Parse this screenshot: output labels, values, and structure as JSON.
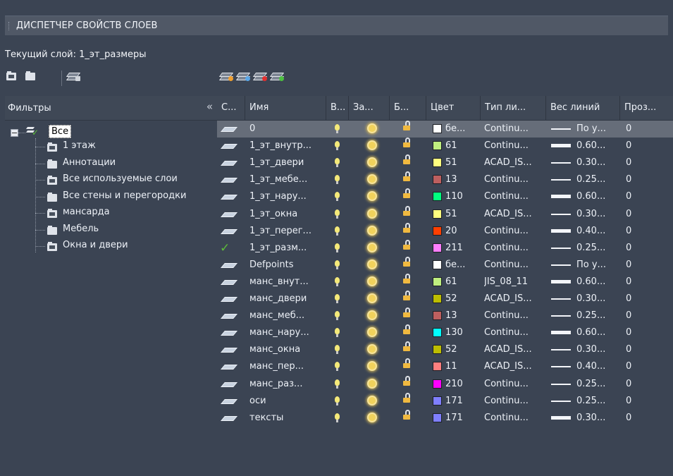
{
  "window": {
    "title": "ДИСПЕТЧЕР СВОЙСТВ СЛОЕВ"
  },
  "current_layer": "Текущий слой: 1_эт_размеры",
  "toolbar_left": [
    "new-property-filter-icon",
    "new-group-filter-icon",
    "layer-states-manager-icon"
  ],
  "toolbar_right": [
    "new-layer-icon",
    "new-layer-vp-frozen-icon",
    "delete-layer-icon",
    "set-current-icon"
  ],
  "filters": {
    "header": "Фильтры",
    "collapse": "«",
    "root": "Все",
    "items": [
      "1 этаж",
      "Аннотации",
      "Все используемые слои",
      "Все стены и перегородки",
      "мансарда",
      "Мебель",
      "Окна и двери"
    ]
  },
  "columns": [
    "С...",
    "Имя",
    "В...",
    "За...",
    "Б...",
    "Цвет",
    "Тип ли...",
    "Вес линий",
    "Проз..."
  ],
  "rows": [
    {
      "name": "0",
      "state": "layer",
      "color": "#ffffff",
      "color_label": "бе...",
      "linetype": "Continu...",
      "lw_thick": false,
      "lineweight": "По у...",
      "transparency": "0",
      "selected": true
    },
    {
      "name": "1_эт_внутр...",
      "state": "layer",
      "color": "#bfef7f",
      "color_label": "61",
      "linetype": "Continu...",
      "lw_thick": true,
      "lineweight": "0.60...",
      "transparency": "0",
      "selected": false
    },
    {
      "name": "1_эт_двери",
      "state": "layer",
      "color": "#ffff7f",
      "color_label": "51",
      "linetype": "ACAD_IS...",
      "lw_thick": false,
      "lineweight": "0.30...",
      "transparency": "0",
      "selected": false
    },
    {
      "name": "1_эт_мебе...",
      "state": "layer",
      "color": "#bd5f5f",
      "color_label": "13",
      "linetype": "Continu...",
      "lw_thick": false,
      "lineweight": "0.25...",
      "transparency": "0",
      "selected": false
    },
    {
      "name": "1_эт_нару...",
      "state": "layer",
      "color": "#00ff7f",
      "color_label": "110",
      "linetype": "Continu...",
      "lw_thick": true,
      "lineweight": "0.60...",
      "transparency": "0",
      "selected": false
    },
    {
      "name": "1_эт_окна",
      "state": "layer",
      "color": "#ffff7f",
      "color_label": "51",
      "linetype": "ACAD_IS...",
      "lw_thick": false,
      "lineweight": "0.30...",
      "transparency": "0",
      "selected": false
    },
    {
      "name": "1_эт_перег...",
      "state": "layer",
      "color": "#ff3f00",
      "color_label": "20",
      "linetype": "Continu...",
      "lw_thick": true,
      "lineweight": "0.40...",
      "transparency": "0",
      "selected": false
    },
    {
      "name": "1_эт_разм...",
      "state": "current",
      "color": "#ff7fff",
      "color_label": "211",
      "linetype": "Continu...",
      "lw_thick": false,
      "lineweight": "0.25...",
      "transparency": "0",
      "selected": false
    },
    {
      "name": "Defpoints",
      "state": "layer",
      "color": "#ffffff",
      "color_label": "бе...",
      "linetype": "Continu...",
      "lw_thick": false,
      "lineweight": "По у...",
      "transparency": "0",
      "selected": false
    },
    {
      "name": "манс_внут...",
      "state": "layer",
      "color": "#bfef7f",
      "color_label": "61",
      "linetype": "JIS_08_11",
      "lw_thick": true,
      "lineweight": "0.60...",
      "transparency": "0",
      "selected": false
    },
    {
      "name": "манс_двери",
      "state": "layer",
      "color": "#bdbd00",
      "color_label": "52",
      "linetype": "ACAD_IS...",
      "lw_thick": false,
      "lineweight": "0.30...",
      "transparency": "0",
      "selected": false
    },
    {
      "name": "манс_меб...",
      "state": "layer",
      "color": "#bd5f5f",
      "color_label": "13",
      "linetype": "Continu...",
      "lw_thick": false,
      "lineweight": "0.25...",
      "transparency": "0",
      "selected": false
    },
    {
      "name": "манс_нару...",
      "state": "layer",
      "color": "#00ffff",
      "color_label": "130",
      "linetype": "Continu...",
      "lw_thick": true,
      "lineweight": "0.60...",
      "transparency": "0",
      "selected": false
    },
    {
      "name": "манс_окна",
      "state": "layer",
      "color": "#bdbd00",
      "color_label": "52",
      "linetype": "ACAD_IS...",
      "lw_thick": false,
      "lineweight": "0.30...",
      "transparency": "0",
      "selected": false
    },
    {
      "name": "манс_пер...",
      "state": "layer",
      "color": "#ff7f7f",
      "color_label": "11",
      "linetype": "ACAD_IS...",
      "lw_thick": false,
      "lineweight": "0.40...",
      "transparency": "0",
      "selected": false
    },
    {
      "name": "манс_раз...",
      "state": "layer",
      "color": "#ff00ff",
      "color_label": "210",
      "linetype": "Continu...",
      "lw_thick": false,
      "lineweight": "0.25...",
      "transparency": "0",
      "selected": false
    },
    {
      "name": "оси",
      "state": "layer",
      "color": "#7f7fff",
      "color_label": "171",
      "linetype": "Continu...",
      "lw_thick": false,
      "lineweight": "0.25...",
      "transparency": "0",
      "selected": false
    },
    {
      "name": "тексты",
      "state": "layer",
      "color": "#7f7fff",
      "color_label": "171",
      "linetype": "Continu...",
      "lw_thick": true,
      "lineweight": "0.30...",
      "transparency": "0",
      "selected": false
    }
  ]
}
